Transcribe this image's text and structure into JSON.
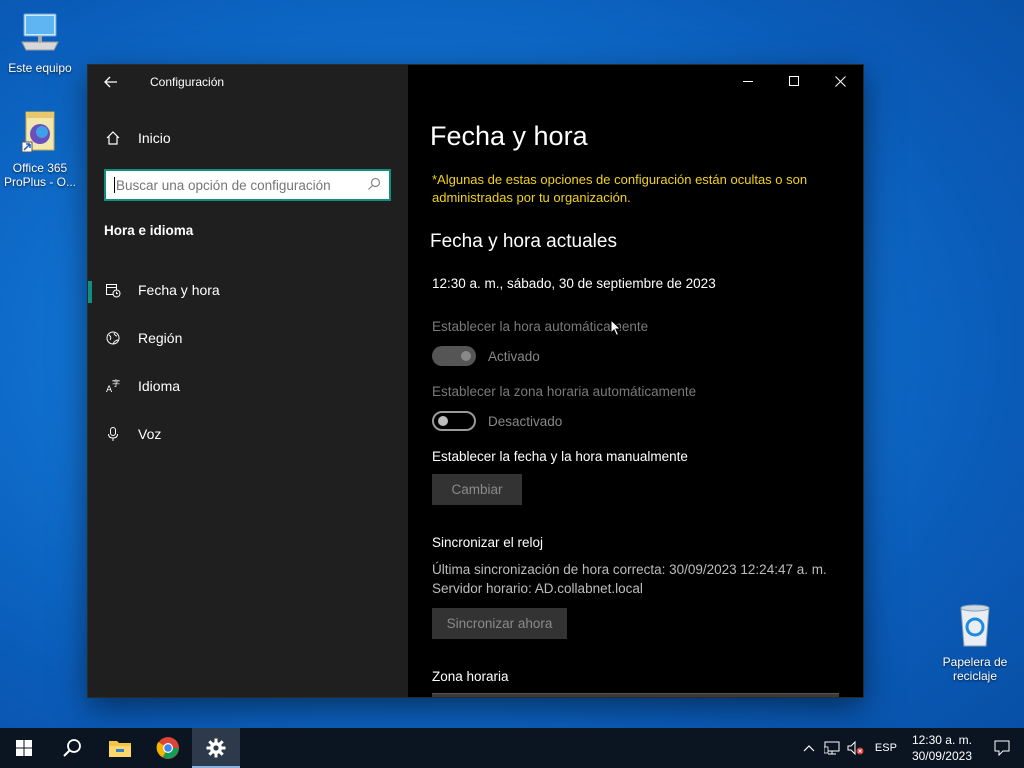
{
  "desktop": {
    "icons": [
      {
        "label": "Este equipo"
      },
      {
        "label": "Office 365 ProPlus - O..."
      },
      {
        "label": "Papelera de reciclaje"
      }
    ]
  },
  "window": {
    "title": "Configuración",
    "controls": {
      "minimize": "—",
      "maximize": "☐",
      "close": "✕"
    }
  },
  "sidebar": {
    "home_label": "Inicio",
    "search_placeholder": "Buscar una opción de configuración",
    "section": "Hora e idioma",
    "items": [
      {
        "label": "Fecha y hora",
        "icon": "calendar-clock-icon",
        "active": true
      },
      {
        "label": "Región",
        "icon": "globe-icon"
      },
      {
        "label": "Idioma",
        "icon": "language-icon"
      },
      {
        "label": "Voz",
        "icon": "microphone-icon"
      }
    ]
  },
  "content": {
    "title": "Fecha y hora",
    "policy_note": "*Algunas de estas opciones de configuración están ocultas o son administradas por tu organización.",
    "current_header": "Fecha y hora actuales",
    "current_datetime": "12:30 a. m., sábado, 30 de septiembre de 2023",
    "auto_time": {
      "label": "Establecer la hora automáticamente",
      "state": "Activado",
      "on": true,
      "disabled": true
    },
    "auto_zone": {
      "label": "Establecer la zona horaria automáticamente",
      "state": "Desactivado",
      "on": false
    },
    "manual": {
      "label": "Establecer la fecha y la hora manualmente",
      "button": "Cambiar"
    },
    "sync": {
      "header": "Sincronizar el reloj",
      "last_sync": "Última sincronización de hora correcta: 30/09/2023 12:24:47 a. m.",
      "server": "Servidor horario: AD.collabnet.local",
      "button": "Sincronizar ahora"
    },
    "timezone_label": "Zona horaria"
  },
  "taskbar": {
    "apps": [
      "start",
      "search",
      "file-explorer",
      "chrome",
      "settings"
    ],
    "language": "ESP",
    "time": "12:30 a. m.",
    "date": "30/09/2023"
  }
}
